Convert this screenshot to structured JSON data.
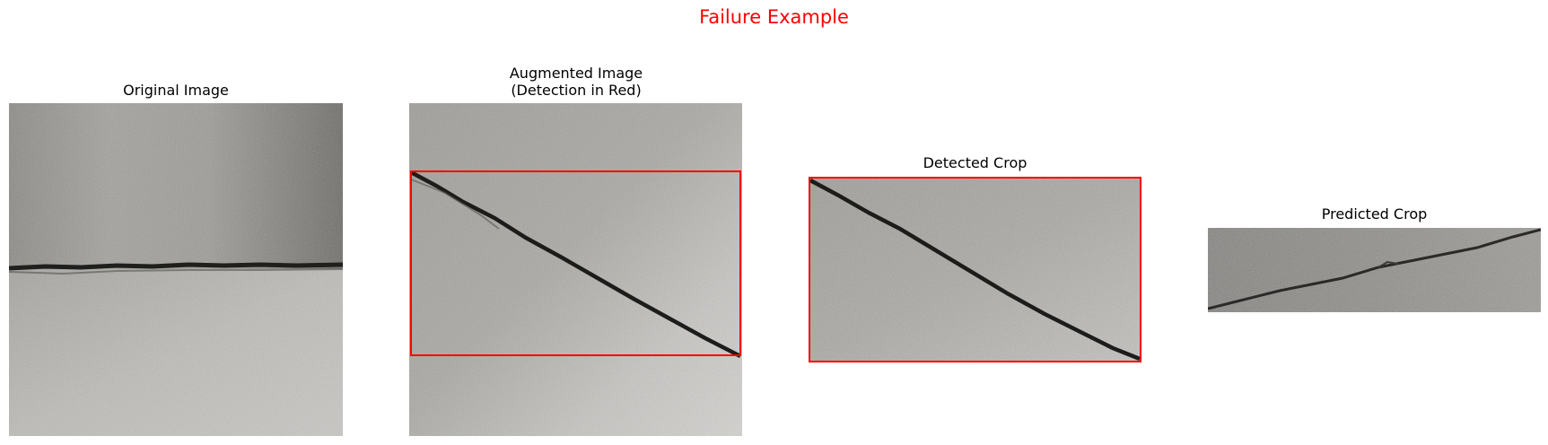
{
  "figure": {
    "suptitle": "Failure Example",
    "suptitle_color": "#ff0000"
  },
  "panels": [
    {
      "title": "Original Image",
      "content": "concrete surface with horizontal crack"
    },
    {
      "title_line1": "Augmented Image",
      "title_line2": "(Detection in Red)",
      "content": "rotated concrete surface with diagonal crack and detection box"
    },
    {
      "title": "Detected Crop",
      "content": "cropped diagonal crack region with red border"
    },
    {
      "title": "Predicted Crop",
      "content": "cropped concrete strip with slanted crack"
    }
  ],
  "box_color": "#ff0000"
}
